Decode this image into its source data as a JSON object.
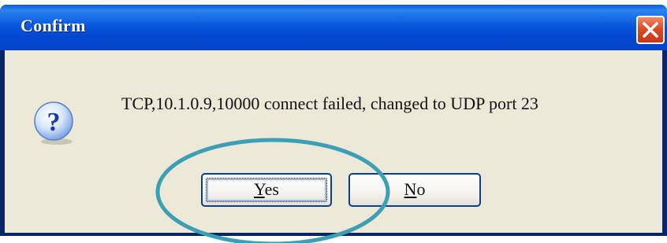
{
  "dialog": {
    "title": "Confirm",
    "icon": "question-icon",
    "message": "TCP,10.1.0.9,10000 connect failed, changed to UDP port 23",
    "buttons": {
      "yes": {
        "accel": "Y",
        "rest": "es"
      },
      "no": {
        "accel": "N",
        "rest": "o"
      }
    },
    "close_icon": "close-icon"
  },
  "annotation": {
    "shape": "ellipse",
    "target": "yes-button",
    "color": "#3d9fb3"
  },
  "colors": {
    "titlebar": "#0958de",
    "client": "#ece9d8",
    "close_button": "#dd4b25",
    "button_border": "#0d3e8a"
  }
}
